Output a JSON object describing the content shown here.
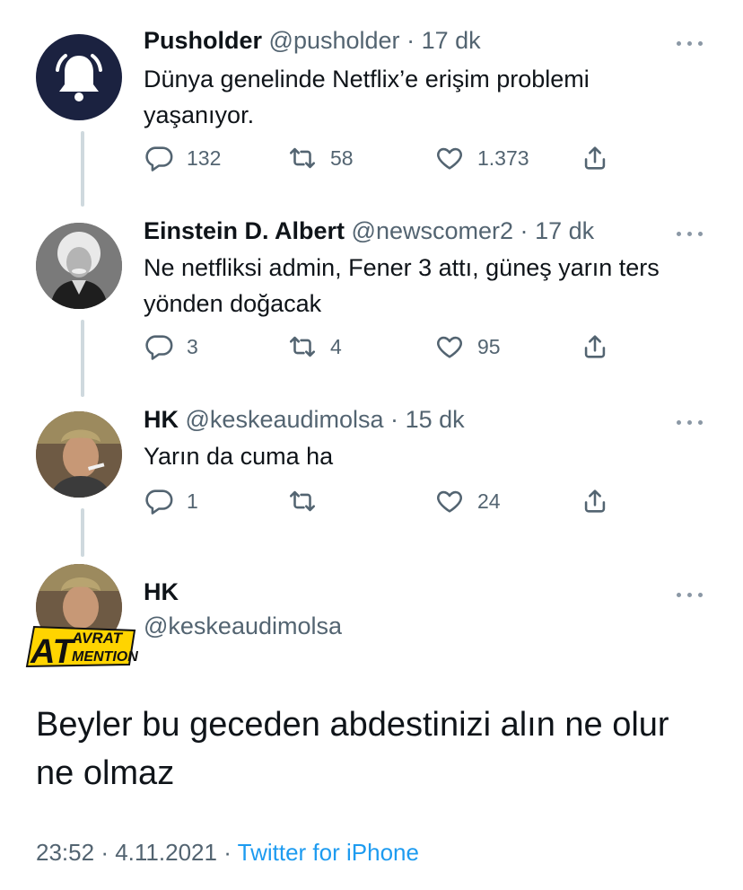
{
  "tweets": [
    {
      "name": "Pusholder",
      "handle": "@pusholder",
      "sep": "·",
      "time": "17 dk",
      "text": "Dünya genelinde Netflix’e erişim problemi yaşanıyor.",
      "replies": "132",
      "retweets": "58",
      "likes": "1.373",
      "avatar_icon": "bell-icon"
    },
    {
      "name": "Einstein D. Albert",
      "handle": "@newscomer2",
      "sep": "·",
      "time": "17 dk",
      "text": "Ne netfliksi admin, Fener 3 attı, güneş yarın ters yönden doğacak",
      "replies": "3",
      "retweets": "4",
      "likes": "95"
    },
    {
      "name": "HK",
      "handle": "@keskeaudimolsa",
      "sep": "·",
      "time": "15 dk",
      "text": "Yarın da cuma ha",
      "replies": "1",
      "retweets": "",
      "likes": "24"
    }
  ],
  "main_tweet": {
    "name": "HK",
    "handle": "@keskeaudimolsa",
    "text": "Beyler bu geceden abdestinizi alın ne olur ne olmaz",
    "time": "23:52",
    "date": "4.11.2021",
    "sep": "·",
    "source": "Twitter for iPhone"
  },
  "watermark": {
    "big": "AT",
    "top": "AVRAT",
    "bottom": "MENTION"
  },
  "colors": {
    "text": "#0f1419",
    "secondary": "#536471",
    "link": "#1d9bf0",
    "thread_line": "#cfd9de",
    "pusholder_avatar": "#1b2240",
    "watermark_yellow": "#ffd400"
  }
}
